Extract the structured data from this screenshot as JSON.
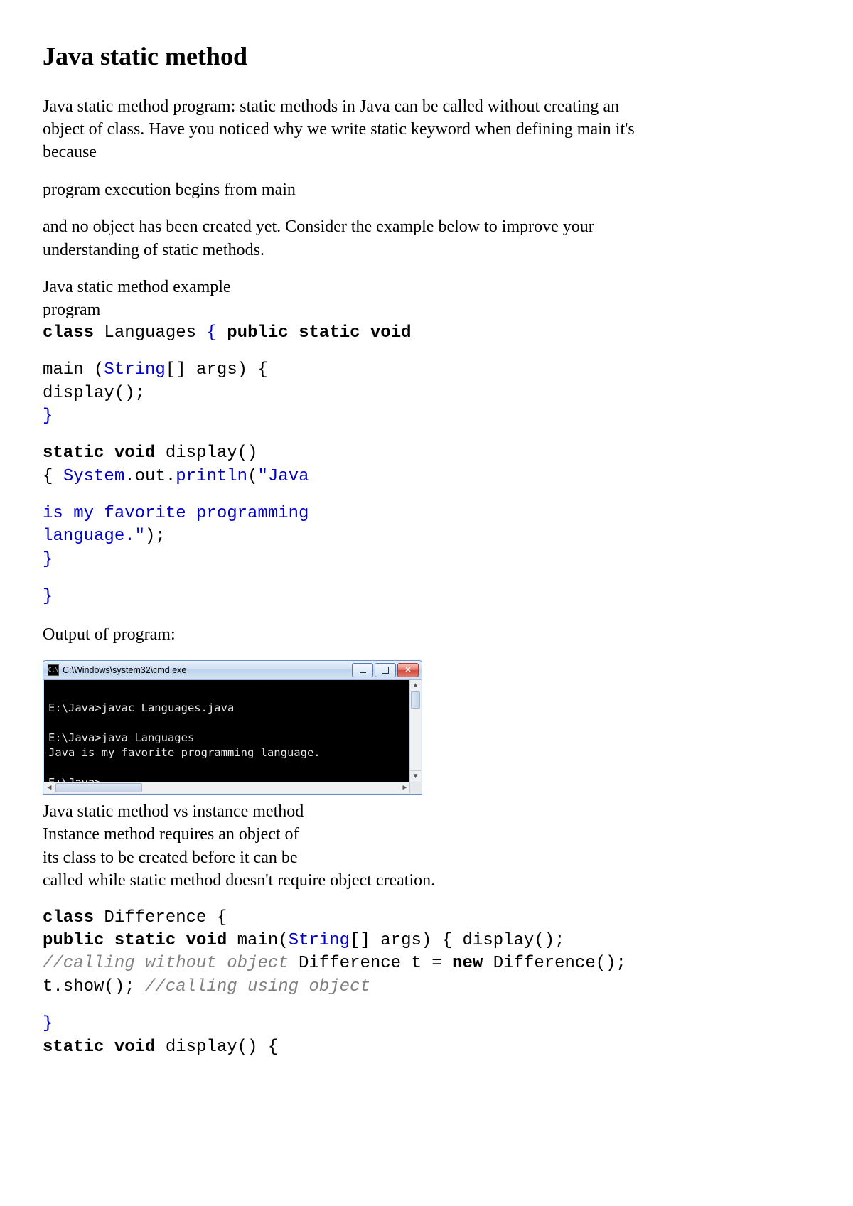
{
  "header": {
    "title": "Java static method"
  },
  "paragraphs": {
    "p1": "Java static method program: static methods in Java can be called without creating an object of class. Have you noticed why we write static keyword when defining main it's because",
    "p2": "program execution begins from main",
    "p3": "and no object has been created yet. Consider the example below to improve your understanding of static methods.",
    "example_intro_l1": "Java static method example",
    "example_intro_l2": "program",
    "out_caption": "Output of program:",
    "section2_l1": "Java static method vs instance method",
    "section2_l2": "Instance method requires an object of",
    "section2_l3": "its class to be created before it can be",
    "section2_p2": "called while static method doesn't require object creation."
  },
  "code1": {
    "l1_kw_class": "class",
    "l1_name": " Languages ",
    "l1_brace": "{",
    "l1_kw_psv": " public static void",
    "l2": "main (",
    "l2_string": "String",
    "l2_rest": "[] args) {",
    "l3": "display();",
    "l4": "}",
    "l5_kw": "static void",
    "l5_name": " display()",
    "l6_open": "{ ",
    "l6_sys": "System",
    "l6_out": ".out.",
    "l6_println": "println",
    "l6_paren": "(",
    "l6_str": "\"Java",
    "l7_str1": "is my favorite programming",
    "l8_str1": "language.\"",
    "l8_close": ");",
    "l9": "}",
    "l10": "}"
  },
  "terminal": {
    "title": "C:\\Windows\\system32\\cmd.exe",
    "l1": "E:\\Java>javac Languages.java",
    "l2": "E:\\Java>java Languages",
    "l3": "Java is my favorite programming language.",
    "l4": "E:\\Java>"
  },
  "code2": {
    "l1_kw": "class",
    "l1_name": " Difference {",
    "l2_kw": "public static void",
    "l2_main": " main(",
    "l2_string": "String",
    "l2_rest": "[] args) { display();",
    "l3_c": "//calling without object",
    "l3_diff": " Difference t = ",
    "l3_new": "new",
    "l3_end": " Difference();",
    "l4_a": "t.show(); ",
    "l4_c": "//calling using object",
    "l5": "}",
    "l6_kw": "static void",
    "l6_rest": " display() {"
  }
}
